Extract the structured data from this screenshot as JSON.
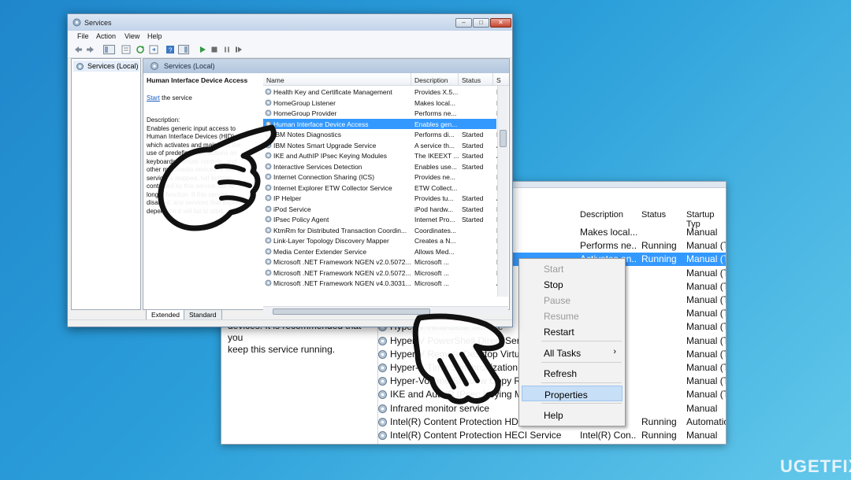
{
  "front_window": {
    "title": "Services",
    "menu": [
      "File",
      "Action",
      "View",
      "Help"
    ],
    "tree_node": "Services (Local)",
    "banner": "Services (Local)",
    "detail": {
      "service_title": "Human Interface Device Access",
      "start_link": "Start",
      "start_suffix": " the service",
      "description_label": "Description:",
      "description_lines": [
        "Enables generic input access to",
        "Human Interface Devices (HID),",
        "which activates and maintains the",
        "use of predefined hot buttons on",
        "keyboards, remote controls, and",
        "other multimedia devices. If this",
        "service is stopped, hot buttons",
        "controlled by this service will no",
        "longer function. If this service is",
        "disabled, any services that explicitly",
        "depend on it will fail to start."
      ]
    },
    "columns": [
      "Name",
      "Description",
      "Status",
      "S"
    ],
    "rows": [
      {
        "name": "Health Key and Certificate Management",
        "desc": "Provides X.5...",
        "status": "",
        "s": "M"
      },
      {
        "name": "HomeGroup Listener",
        "desc": "Makes local...",
        "status": "",
        "s": "M"
      },
      {
        "name": "HomeGroup Provider",
        "desc": "Performs ne...",
        "status": "",
        "s": "M"
      },
      {
        "name": "Human Interface Device Access",
        "desc": "Enables gen...",
        "status": "",
        "s": "M",
        "selected": true
      },
      {
        "name": "IBM Notes Diagnostics",
        "desc": "Performs di...",
        "status": "Started",
        "s": "M"
      },
      {
        "name": "IBM Notes Smart Upgrade Service",
        "desc": "A service th...",
        "status": "Started",
        "s": "A"
      },
      {
        "name": "IKE and AuthIP IPsec Keying Modules",
        "desc": "The IKEEXT ...",
        "status": "Started",
        "s": "A"
      },
      {
        "name": "Interactive Services Detection",
        "desc": "Enables use...",
        "status": "Started",
        "s": "M"
      },
      {
        "name": "Internet Connection Sharing (ICS)",
        "desc": "Provides ne...",
        "status": "",
        "s": "D"
      },
      {
        "name": "Internet Explorer ETW Collector Service",
        "desc": "ETW Collect...",
        "status": "",
        "s": "M"
      },
      {
        "name": "IP Helper",
        "desc": "Provides tu...",
        "status": "Started",
        "s": "A"
      },
      {
        "name": "iPod Service",
        "desc": "iPod hardw...",
        "status": "Started",
        "s": "M"
      },
      {
        "name": "IPsec Policy Agent",
        "desc": "Internet Pro...",
        "status": "Started",
        "s": "M"
      },
      {
        "name": "KtmRm for Distributed Transaction Coordin...",
        "desc": "Coordinates...",
        "status": "",
        "s": "M"
      },
      {
        "name": "Link-Layer Topology Discovery Mapper",
        "desc": "Creates a N...",
        "status": "",
        "s": "M"
      },
      {
        "name": "Media Center Extender Service",
        "desc": "Allows Med...",
        "status": "",
        "s": "D"
      },
      {
        "name": "Microsoft .NET Framework NGEN v2.0.5072...",
        "desc": "Microsoft ...",
        "status": "",
        "s": "D"
      },
      {
        "name": "Microsoft .NET Framework NGEN v2.0.5072...",
        "desc": "Microsoft ...",
        "status": "",
        "s": "D"
      },
      {
        "name": "Microsoft .NET Framework NGEN v4.0.3031...",
        "desc": "Microsoft ...",
        "status": "",
        "s": "A"
      }
    ],
    "tabs": [
      "Extended",
      "Standard"
    ]
  },
  "back_window": {
    "columns": [
      "Description",
      "Status",
      "Startup Typ"
    ],
    "desc_fragment_1": "devices. It is recommended that you",
    "desc_fragment_2": "keep this service running.",
    "rows": [
      {
        "name": "",
        "desc": "Makes local...",
        "status": "",
        "startup": "Manual"
      },
      {
        "name": "",
        "desc": "Performs ne...",
        "status": "Running",
        "startup": "Manual (Tr"
      },
      {
        "name": "",
        "desc": "Activates an...",
        "status": "Running",
        "startup": "Manual (Tr",
        "selected": true
      },
      {
        "name": "",
        "desc": "",
        "status": "",
        "startup": "Manual (Tr"
      },
      {
        "name": "",
        "desc": "",
        "status": "",
        "startup": "Manual (Tr"
      },
      {
        "name": "",
        "desc": "",
        "status": "",
        "startup": "Manual (Tr"
      },
      {
        "name": "",
        "desc": "",
        "status": "",
        "startup": "Manual (Tr"
      },
      {
        "name": "Hyper-V Heartbeat Service",
        "desc": "",
        "status": "",
        "startup": "Manual (Tr"
      },
      {
        "name": "Hyper-V PowerShell Direct Service",
        "desc": "",
        "status": "",
        "startup": "Manual (Tr"
      },
      {
        "name": "Hyper-V Remote Desktop Virtualization Service",
        "desc": "",
        "status": "",
        "startup": "Manual (Tr"
      },
      {
        "name": "Hyper-V Time Synchronization Service",
        "desc": "",
        "status": "",
        "startup": "Manual (Tr"
      },
      {
        "name": "Hyper-Volume Shadow Copy Requestor",
        "desc": "",
        "status": "",
        "startup": "Manual (Tr"
      },
      {
        "name": "IKE and AuthIP IPsec Keying Modules",
        "desc": "",
        "status": "",
        "startup": "Manual (Tr"
      },
      {
        "name": "Infrared monitor service",
        "desc": "",
        "status": "",
        "startup": "Manual"
      },
      {
        "name": "Intel(R) Content Protection HDCP Service",
        "desc": "",
        "status": "Running",
        "startup": "Automatic"
      },
      {
        "name": "Intel(R) Content Protection HECI Service",
        "desc": "Intel(R) Con...",
        "status": "Running",
        "startup": "Manual"
      }
    ]
  },
  "context_menu": {
    "items": [
      {
        "label": "Start",
        "disabled": true
      },
      {
        "label": "Stop",
        "disabled": false
      },
      {
        "label": "Pause",
        "disabled": true
      },
      {
        "label": "Resume",
        "disabled": true
      },
      {
        "label": "Restart",
        "disabled": false
      },
      {
        "label": "All Tasks",
        "disabled": false,
        "submenu": true
      },
      {
        "label": "Refresh",
        "disabled": false
      },
      {
        "label": "Properties",
        "disabled": false,
        "highlighted": true
      },
      {
        "label": "Help",
        "disabled": false
      }
    ]
  },
  "watermark": "UGETFIX",
  "colors": {
    "selection": "#3399ff",
    "background": "#2b9fda"
  }
}
